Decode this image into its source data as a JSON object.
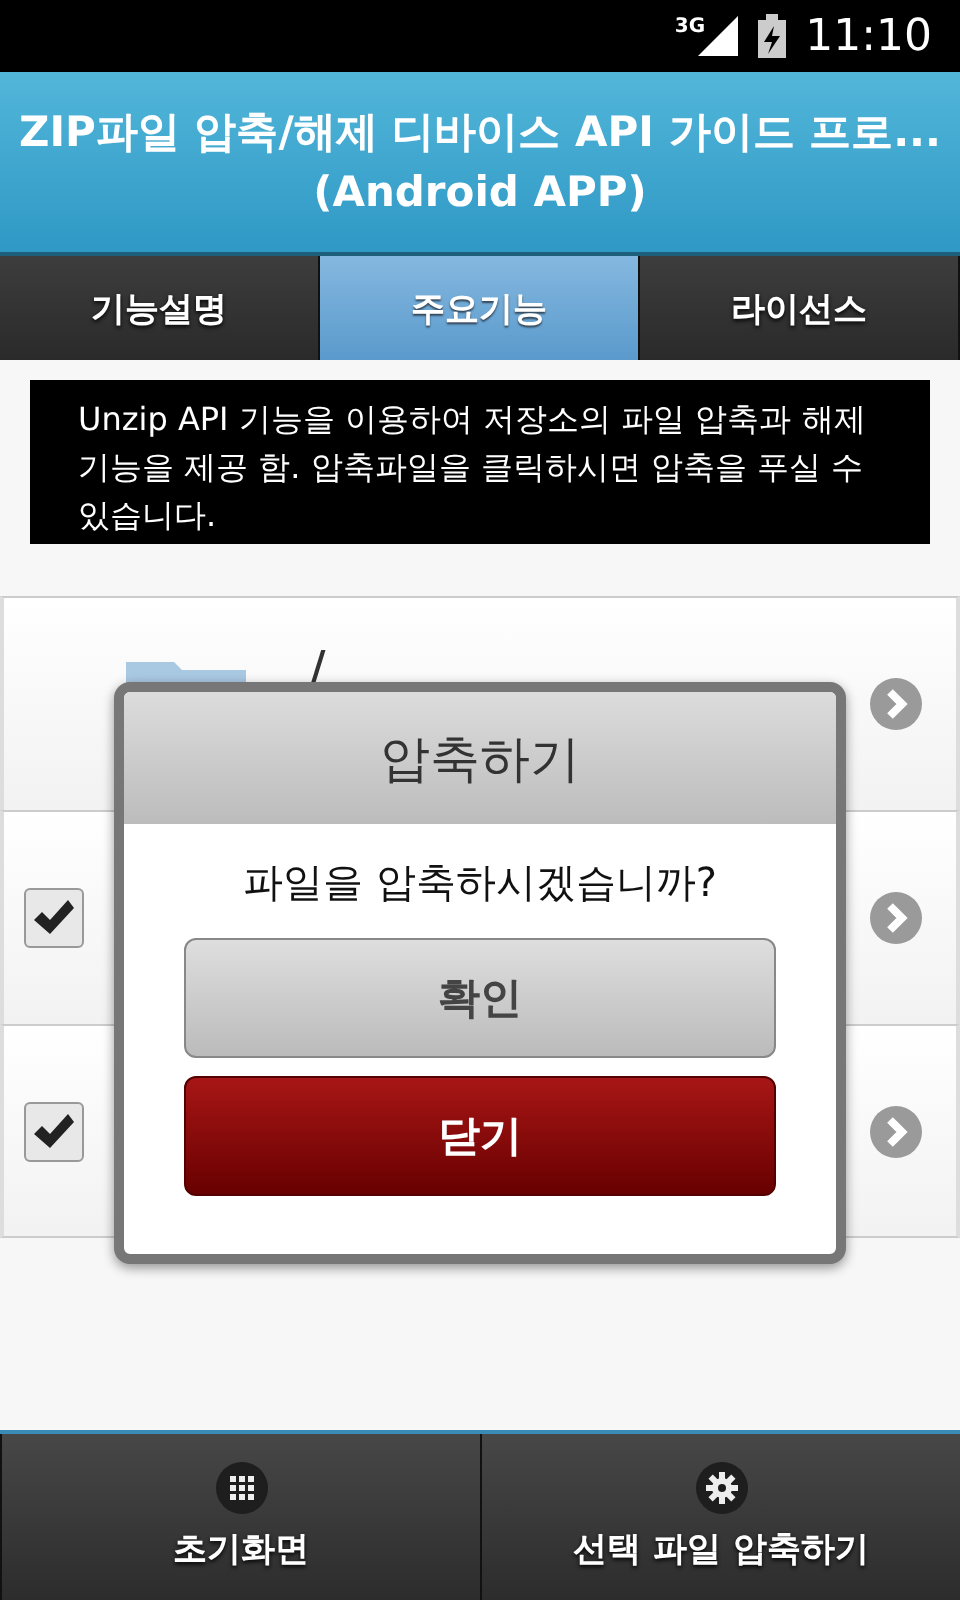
{
  "status_bar": {
    "network": "3G",
    "time": "11:10"
  },
  "title_lines": [
    "ZIP파일 압축/해제 디바이스 API 가이드 프로...",
    "(Android APP)"
  ],
  "tabs": [
    {
      "label": "기능설명",
      "selected": false
    },
    {
      "label": "주요기능",
      "selected": true
    },
    {
      "label": "라이선스",
      "selected": false
    }
  ],
  "description": "Unzip API 기능을 이용하여 저장소의 파일 압축과 해제 기능을 제공 함. 압축파일을 클릭하시면 압축을 푸실 수 있습니다.",
  "files": [
    {
      "kind": "folder",
      "name": "/"
    },
    {
      "kind": "file",
      "checked": true
    },
    {
      "kind": "file",
      "checked": true
    }
  ],
  "dialog": {
    "title": "압축하기",
    "message": "파일을 압축하시겠습니까?",
    "buttons": [
      {
        "label": "확인",
        "kind": "confirm"
      },
      {
        "label": "닫기",
        "kind": "close"
      }
    ]
  },
  "bottom_nav": [
    {
      "label": "초기화면",
      "kind": "home"
    },
    {
      "label": "선택 파일 압축하기",
      "kind": "compress"
    }
  ]
}
